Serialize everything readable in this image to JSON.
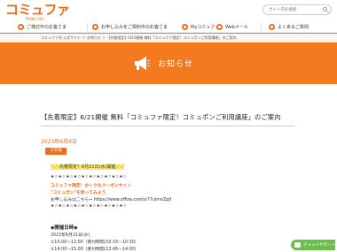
{
  "header": {
    "logo_main": "コミュファ",
    "logo_sub": "from ctc",
    "search_placeholder": "サイト内を検索",
    "nav": [
      {
        "label": "ご検討中のお客さま",
        "icon": "user-icon"
      },
      {
        "label": "お申し込みをご契約中のお客さま",
        "icon": "contract-icon"
      },
      {
        "label": "Myコミュファ",
        "icon": "my-icon"
      },
      {
        "label": "Webメール",
        "icon": "mail-icon"
      },
      {
        "label": "よくあるご質問",
        "icon": "question-icon"
      }
    ]
  },
  "breadcrumb": "コミュファ光 公式サイト ＞ お知らせ ＞ 【先着限定】6/21開催 無料「コミュファ限定！コミュポンご利用講座」のご案内",
  "banner": {
    "title": "お知らせ",
    "icon": "megaphone-icon"
  },
  "article": {
    "title": "【先着限定】6/21開催 無料「コミュファ限定！コミュポンご利用講座」のご案内",
    "date": "2023年6月8日",
    "category": "その他",
    "highlight": "＼＼先着限定！6月21日(水)開催／／",
    "stars1": "★☆★☆★☆★☆★☆★☆★☆★☆★☆★☆",
    "promo1": "コミュファ限定！おトクなクーポンサイト",
    "promo2": "\"コミュポン\"を使ってみよう",
    "apply": "お申し込みはこちら⇒ https://www.offiza.com/s/?7ulmnZpjf",
    "stars2": "★☆★☆★☆★☆★☆★☆★☆★☆★☆★☆",
    "section": "◆開催日時◆",
    "sched_date": "2023年6月21日(水)",
    "sched1": "①10:00～12:00（受付時間/10:15～10:30）",
    "sched2": "②14:00～15:00（受付時間/13:45～14:00）"
  },
  "chat": {
    "label": "チャットサポート"
  },
  "colors": {
    "brand": "#f26b1d",
    "banner": "#f47a20",
    "chat": "#6abf4b",
    "highlight": "#ffe866"
  }
}
